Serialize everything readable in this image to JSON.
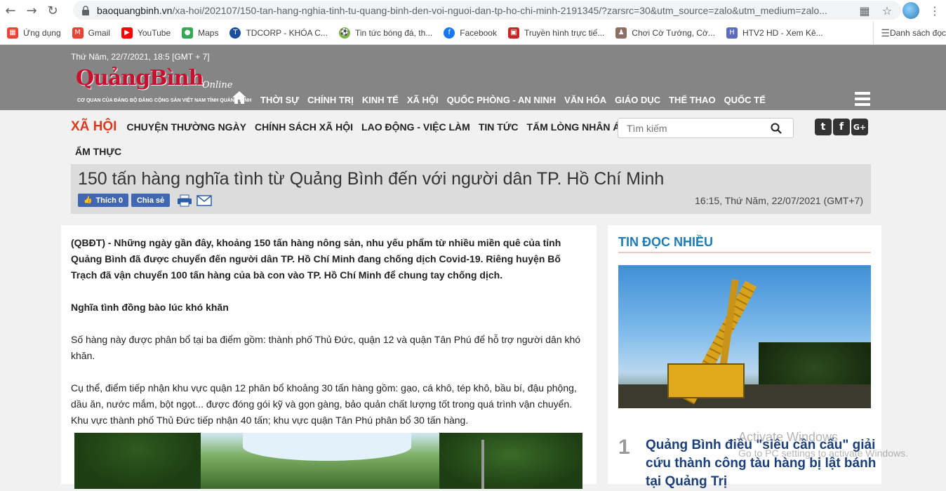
{
  "browser": {
    "url_host": "baoquangbinh.vn",
    "url_path": "/xa-hoi/202107/150-tan-hang-nghia-tinh-tu-quang-binh-den-voi-nguoi-dan-tp-ho-chi-minh-2191345/?zarsrc=30&utm_source=zalo&utm_medium=zalo...",
    "bookmarks": [
      {
        "label": "Ứng dụng",
        "icon": "apps-grid-icon",
        "color": "#ea4335"
      },
      {
        "label": "Gmail",
        "icon": "gmail-icon",
        "color": "#ea4335"
      },
      {
        "label": "YouTube",
        "icon": "youtube-icon",
        "color": "#ff0000"
      },
      {
        "label": "Maps",
        "icon": "maps-pin-icon",
        "color": "#34a853"
      },
      {
        "label": "TDCORP - KHÓA C...",
        "icon": "tdcorp-icon",
        "color": "#1a4fa0"
      },
      {
        "label": "Tin tức bóng đá, th...",
        "icon": "soccer-icon",
        "color": "#7cb342"
      },
      {
        "label": "Facebook",
        "icon": "facebook-icon",
        "color": "#1877f2"
      },
      {
        "label": "Truyền hình trực tiế...",
        "icon": "tv-icon",
        "color": "#c62828"
      },
      {
        "label": "Chơi Cờ Tướng, Cờ...",
        "icon": "chess-icon",
        "color": "#8d6e63"
      },
      {
        "label": "HTV2 HD - Xem Kê...",
        "icon": "htv-icon",
        "color": "#5c6bc0"
      }
    ],
    "reading_list": "Danh sách đọc"
  },
  "header": {
    "date": "Thứ Năm, 22/7/2021, 18:5 [GMT + 7]",
    "logo_main": "QuảngBình",
    "logo_online": "Online",
    "logo_sub": "CƠ QUAN CỦA ĐẢNG BỘ ĐẢNG CỘNG SẢN VIỆT NAM TỈNH QUẢNG BÌNH",
    "nav": [
      "THỜI SỰ",
      "CHÍNH TRỊ",
      "KINH TẾ",
      "XÃ HỘI",
      "QUỐC PHÒNG - AN NINH",
      "VĂN HÓA",
      "GIÁO DỤC",
      "THỂ THAO",
      "QUỐC TẾ"
    ]
  },
  "subnav": {
    "section": "XÃ HỘI",
    "items": [
      "CHUYỆN THƯỜNG NGÀY",
      "CHÍNH SÁCH XÃ HỘI",
      "LAO ĐỘNG - VIỆC LÀM",
      "TIN TỨC",
      "TẤM LÒNG NHÂN ÁI"
    ],
    "items_row2": "ẨM THỰC"
  },
  "search": {
    "placeholder": "Tìm kiếm"
  },
  "social": {
    "twitter": "t",
    "facebook": "f",
    "google": "G+"
  },
  "article": {
    "title": "150 tấn hàng nghĩa tình từ Quảng Bình đến với người dân TP. Hồ Chí Minh",
    "like_label": "Thích 0",
    "share_label": "Chia sẻ",
    "published": "16:15, Thứ Năm, 22/07/2021 (GMT+7)",
    "lead": "(QBĐT) - Những ngày gần đây, khoảng 150 tấn hàng nông sản, nhu yếu phẩm từ nhiều miền quê của tỉnh Quảng Bình đã được chuyển đến người dân TP. Hồ Chí Minh đang chống dịch Covid-19. Riêng huyện Bố Trạch đã vận chuyển 100 tấn hàng của bà con vào TP. Hồ Chí Minh để chung tay chống dịch.",
    "subhead": "Nghĩa tình đồng bào lúc khó khăn",
    "p1": "Số hàng này được phân bổ tại ba điểm gồm: thành phố Thủ Đức, quận 12 và quận Tân Phú để hỗ trợ người dân khó khăn.",
    "p2": "Cụ thể, điểm tiếp nhận khu vực quận 12 phân bổ khoảng 30 tấn hàng gồm: gạo, cá khô, tép khô, bầu bí, đậu phộng, dầu ăn, nước mắm, bột ngọt... được đóng gói kỹ và gọn gàng, bảo quản chất lượng tốt trong quá trình vận chuyển. Khu vực thành phố Thủ Đức tiếp nhận 40 tấn; khu vực quận Tân Phú phân bổ 30 tấn hàng."
  },
  "sidebar": {
    "title": "TIN ĐỌC NHIỀU",
    "items": [
      {
        "rank": "1",
        "headline": "Quảng Bình điều \"siêu cần cẩu\" giải cứu thành công tàu hàng bị lật bánh tại Quảng Trị"
      }
    ]
  },
  "watermark": {
    "line1": "Activate Windows",
    "line2": "Go to PC settings to activate Windows."
  },
  "colors": {
    "header_bg": "#858585",
    "section_red": "#d83c1e",
    "sidebar_title_blue": "#1e7bb5",
    "facebook_blue": "#4267b2"
  }
}
